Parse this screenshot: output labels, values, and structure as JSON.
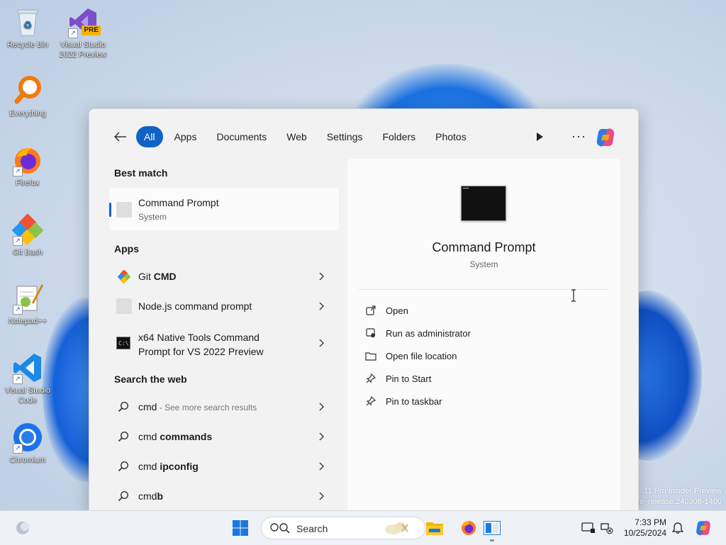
{
  "desktop": {
    "icons": [
      {
        "label": "Recycle Bin"
      },
      {
        "label": "Visual Studio 2022 Preview",
        "badge": "PRE"
      },
      {
        "label": "Everything"
      },
      {
        "label": "Firefox"
      },
      {
        "label": "Git Bash"
      },
      {
        "label": "Notepad++"
      },
      {
        "label": "Visual Studio Code"
      },
      {
        "label": "Chromium"
      }
    ],
    "watermark": [
      "11 Pro Insider Preview",
      "ge_release.240308-1400"
    ]
  },
  "start": {
    "filters": [
      "All",
      "Apps",
      "Documents",
      "Web",
      "Settings",
      "Folders",
      "Photos"
    ],
    "active_filter": "All",
    "more_label": "···",
    "best_match": {
      "heading": "Best match",
      "name": "Command Prompt",
      "sub": "System"
    },
    "apps": {
      "heading": "Apps",
      "items": [
        {
          "pre": "Git ",
          "bold": "CMD",
          "icon": "git-icon"
        },
        {
          "pre": "Node.js command prompt",
          "bold": "",
          "icon": "generic-app-icon"
        },
        {
          "line1": "x64 Native Tools Command",
          "line2": "Prompt for VS 2022 Preview",
          "icon": "terminal-icon"
        }
      ]
    },
    "web": {
      "heading": "Search the web",
      "items": [
        {
          "pre": "cmd",
          "muted": " - See more search results",
          "bold": ""
        },
        {
          "pre": "cmd ",
          "muted": "",
          "bold": "commands"
        },
        {
          "pre": "cmd ",
          "muted": "",
          "bold": "ipconfig"
        },
        {
          "pre": "cmd",
          "muted": "",
          "bold": "b"
        }
      ]
    },
    "preview": {
      "title": "Command Prompt",
      "sub": "System",
      "actions": [
        "Open",
        "Run as administrator",
        "Open file location",
        "Pin to Start",
        "Pin to taskbar"
      ]
    }
  },
  "taskbar": {
    "search_placeholder": "Search",
    "time": "7:33 PM",
    "date": "10/25/2024"
  },
  "colors": {
    "accent": "#1062c6",
    "panel": "#f2f2f2"
  }
}
